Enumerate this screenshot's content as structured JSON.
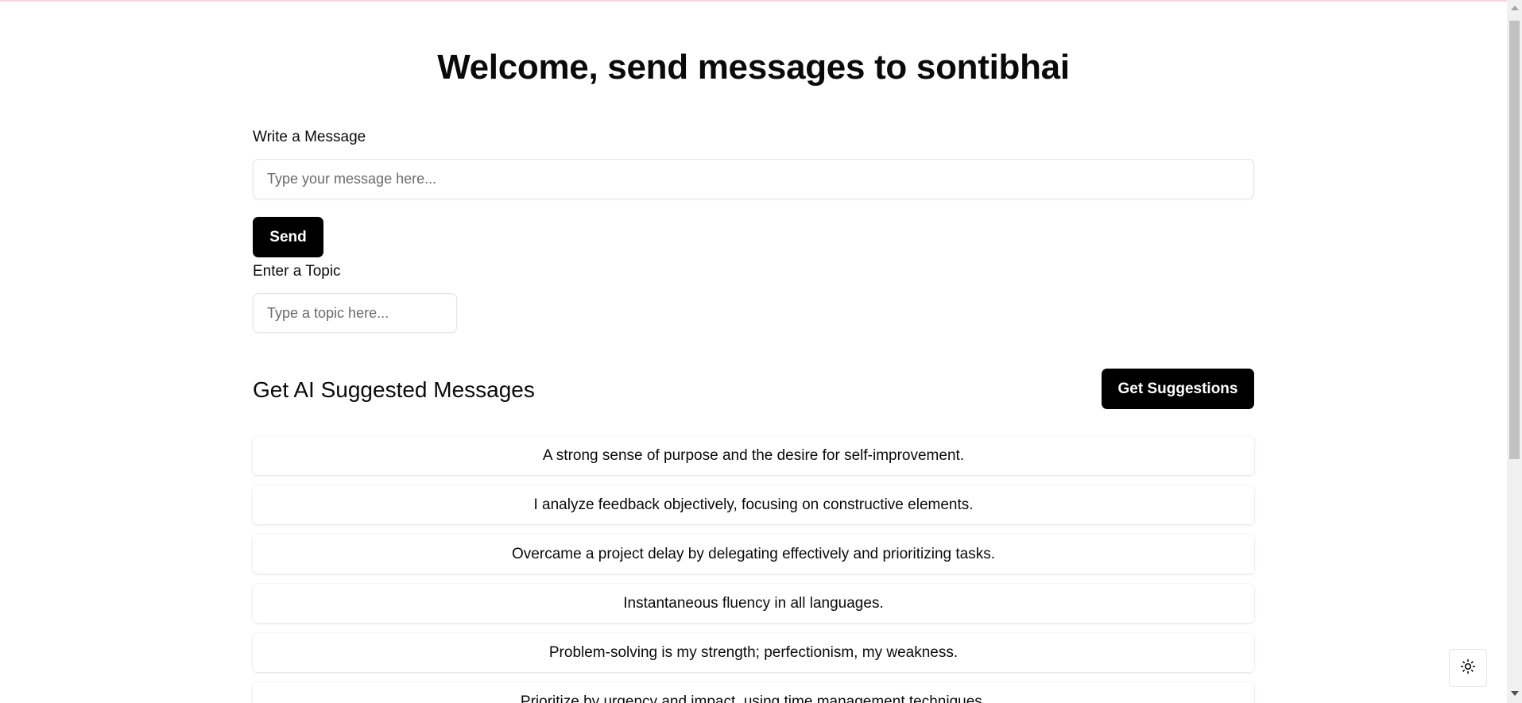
{
  "header": {
    "title": "Welcome, send messages to sontibhai"
  },
  "message_form": {
    "label": "Write a Message",
    "placeholder": "Type your message here...",
    "value": "",
    "send_label": "Send"
  },
  "topic_form": {
    "label": "Enter a Topic",
    "placeholder": "Type a topic here...",
    "value": ""
  },
  "suggestions_section": {
    "title": "Get AI Suggested Messages",
    "button_label": "Get Suggestions",
    "items": [
      "A strong sense of purpose and the desire for self-improvement.",
      "I analyze feedback objectively, focusing on constructive elements.",
      "Overcame a project delay by delegating effectively and prioritizing tasks.",
      "Instantaneous fluency in all languages.",
      "Problem-solving is my strength; perfectionism, my weakness.",
      "Prioritize by urgency and impact, using time management techniques."
    ]
  },
  "theme_toggle": {
    "icon": "sun-icon"
  },
  "colors": {
    "primary_button": "#000000",
    "button_text": "#ffffff",
    "top_accent": "#f7d4dc"
  }
}
